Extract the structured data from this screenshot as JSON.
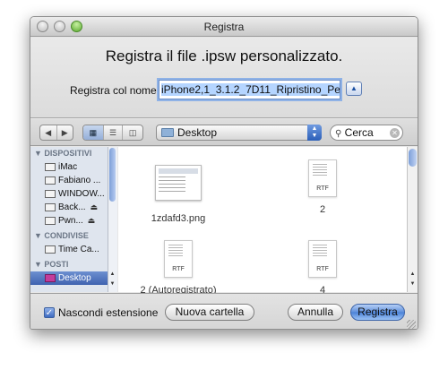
{
  "window": {
    "title": "Registra"
  },
  "dialog": {
    "heading": "Registra il file .ipsw personalizzato.",
    "save_as_label": "Registra col nome:",
    "filename_value": "iPhone2,1_3.1.2_7D11_Ripristino_Pe"
  },
  "toolbar": {
    "location": "Desktop",
    "search_placeholder": "Cerca"
  },
  "sidebar": {
    "sections": [
      {
        "title": "DISPOSITIVI",
        "items": [
          "iMac",
          "Fabiano ...",
          "WINDOW...",
          "Back...",
          "Pwn..."
        ]
      },
      {
        "title": "CONDIVISE",
        "items": [
          "Time Ca..."
        ]
      },
      {
        "title": "POSTI",
        "items": [
          "Desktop"
        ]
      }
    ]
  },
  "files": [
    {
      "name": "1zdafd3.png",
      "kind": "png"
    },
    {
      "name": "2",
      "kind": "RTF"
    },
    {
      "name": "2 (Autoregistrato)",
      "kind": "RTF"
    },
    {
      "name": "4",
      "kind": "RTF"
    }
  ],
  "footer": {
    "hide_extension_label": "Nascondi estensione",
    "new_folder_label": "Nuova cartella",
    "cancel_label": "Annulla",
    "save_label": "Registra"
  }
}
